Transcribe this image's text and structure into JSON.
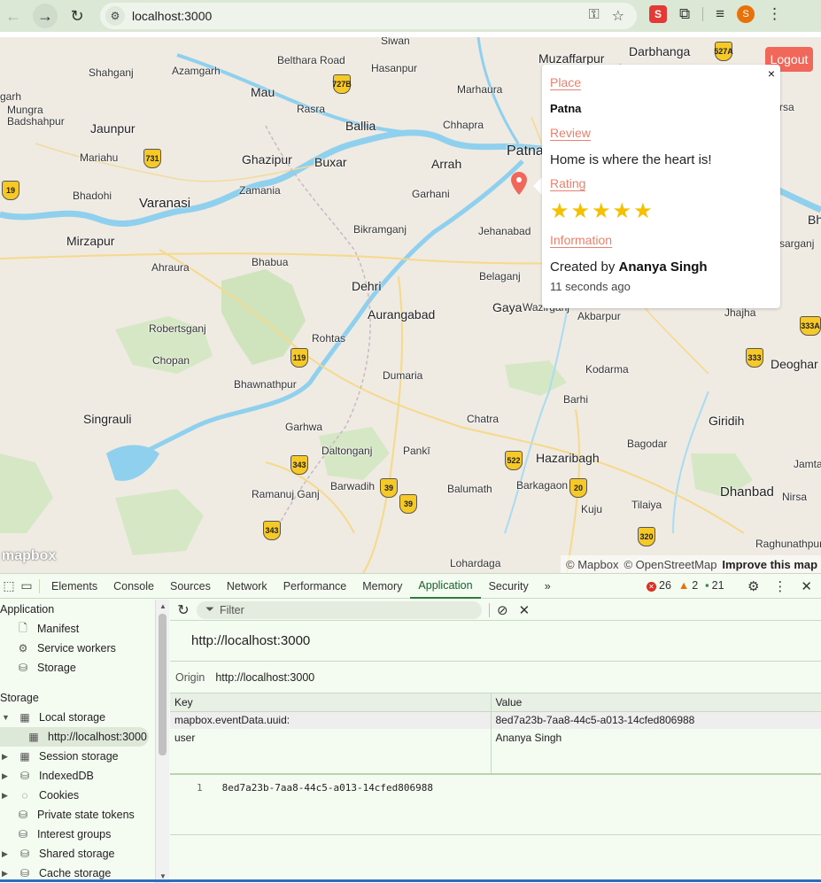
{
  "browser": {
    "url": "localhost:3000",
    "profile_initial": "S"
  },
  "map": {
    "logout_label": "Logout",
    "mapbox_logo": "mapbox",
    "attribution": [
      "© Mapbox",
      "© OpenStreetMap"
    ],
    "improve_label": "Improve this map",
    "places": [
      "Siwan",
      "Muzaffarpur",
      "Darbhanga",
      "Belthara Road",
      "Hasanpur",
      "Shahganj",
      "Azamgarh",
      "Mau",
      "Marhaura",
      "Rasra",
      "Ballia",
      "Chhapra",
      "Mungra Badshahpur",
      "Jaunpur",
      "Mariahu",
      "Ghazipur",
      "Buxar",
      "Arrah",
      "Patna",
      "Zamania",
      "Garhani",
      "Bhadohi",
      "Varanasi",
      "Jehanabad",
      "Mirzapur",
      "Bikramganj",
      "Ahraura",
      "Bhabua",
      "Dehri",
      "Belaganj",
      "Aurangabad",
      "Gaya",
      "Wazirganj",
      "Akbarpur",
      "Robertsganj",
      "Rohtas",
      "Chopan",
      "Jhajha",
      "Deoghar",
      "Dumaria",
      "Kodarma",
      "Bhawnathpur",
      "Barhi",
      "Singrauli",
      "Chatra",
      "Giridih",
      "Garhwa",
      "Pankī",
      "Bagodar",
      "Daltonganj",
      "Hazaribagh",
      "Jamtara",
      "Barwadih",
      "Balumath",
      "Barkagaon",
      "Ramanuj Ganj",
      "Kuju",
      "Tilaiya",
      "Dhanbad",
      "Nirsa",
      "Raghunathpur",
      "Lohardaga",
      "garh",
      "rsa",
      "sarganj",
      "Bh"
    ],
    "highways": [
      "527A",
      "727B",
      "731",
      "19",
      "119",
      "333",
      "333A",
      "343",
      "522",
      "39",
      "20",
      "320",
      "343",
      "39"
    ]
  },
  "popup": {
    "close_label": "×",
    "place_label": "Place",
    "place_value": "Patna",
    "review_label": "Review",
    "review_value": "Home is where the heart is!",
    "rating_label": "Rating",
    "rating": 5,
    "rating_max": 5,
    "info_label": "Information",
    "created_prefix": "Created by",
    "created_by": "Ananya Singh",
    "time_ago": "11 seconds ago"
  },
  "devtools": {
    "tabs": [
      "Elements",
      "Console",
      "Sources",
      "Network",
      "Performance",
      "Memory",
      "Application",
      "Security"
    ],
    "active_tab": "Application",
    "more_tabs": "»",
    "errors": "26",
    "warnings": "2",
    "messages": "21",
    "sidebar": {
      "application_header": "Application",
      "application_items": [
        "Manifest",
        "Service workers",
        "Storage"
      ],
      "storage_header": "Storage",
      "local_storage": "Local storage",
      "local_storage_child": "http://localhost:3000",
      "storage_items": [
        "Session storage",
        "IndexedDB",
        "Cookies",
        "Private state tokens",
        "Interest groups",
        "Shared storage",
        "Cache storage"
      ]
    },
    "filter_placeholder": "Filter",
    "origin_title": "http://localhost:3000",
    "origin_label": "Origin",
    "origin_value": "http://localhost:3000",
    "table": {
      "headers": [
        "Key",
        "Value"
      ],
      "rows": [
        [
          "mapbox.eventData.uuid:",
          "8ed7a23b-7aa8-44c5-a013-14cfed806988"
        ],
        [
          "user",
          "Ananya Singh"
        ]
      ]
    },
    "preview": {
      "line_number": "1",
      "value": "8ed7a23b-7aa8-44c5-a013-14cfed806988"
    }
  }
}
